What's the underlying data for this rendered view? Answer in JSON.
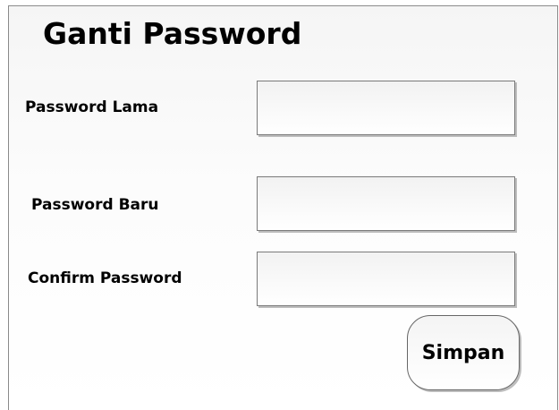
{
  "page": {
    "title": "Ganti Password"
  },
  "form": {
    "old_password": {
      "label": "Password Lama",
      "value": "",
      "placeholder": ""
    },
    "new_password": {
      "label": "Password Baru",
      "value": "",
      "placeholder": ""
    },
    "confirm_password": {
      "label": "Confirm Password",
      "value": "",
      "placeholder": ""
    },
    "save_label": "Simpan"
  }
}
